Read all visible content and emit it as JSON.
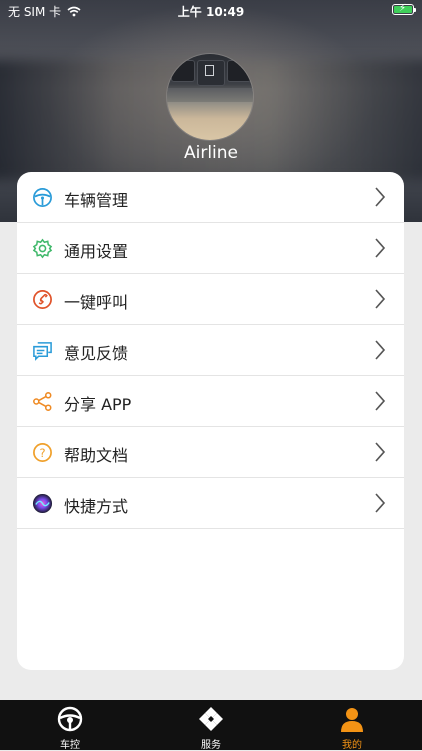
{
  "status_bar": {
    "carrier": "无 SIM 卡",
    "time": "上午 10:49"
  },
  "profile": {
    "username": "Airline"
  },
  "menu": {
    "items": [
      {
        "label": "车辆管理",
        "icon": "steering-wheel-icon",
        "color": "#2a9bd8"
      },
      {
        "label": "通用设置",
        "icon": "gear-icon",
        "color": "#3fb86a"
      },
      {
        "label": "一键呼叫",
        "icon": "phone-icon",
        "color": "#e0532a"
      },
      {
        "label": "意见反馈",
        "icon": "feedback-chat-icon",
        "color": "#2a9bd8"
      },
      {
        "label": "分享 APP",
        "icon": "share-icon",
        "color": "#ef8a23"
      },
      {
        "label": "帮助文档",
        "icon": "help-circle-icon",
        "color": "#f0a02b"
      },
      {
        "label": "快捷方式",
        "icon": "siri-shortcut-icon",
        "color": "#6a3fd8"
      }
    ]
  },
  "tabbar": {
    "tabs": [
      {
        "label": "车控",
        "icon": "steering-wheel-icon",
        "active": false
      },
      {
        "label": "服务",
        "icon": "clover-grid-icon",
        "active": false
      },
      {
        "label": "我的",
        "icon": "person-icon",
        "active": true
      }
    ],
    "active_color": "#f39315"
  }
}
